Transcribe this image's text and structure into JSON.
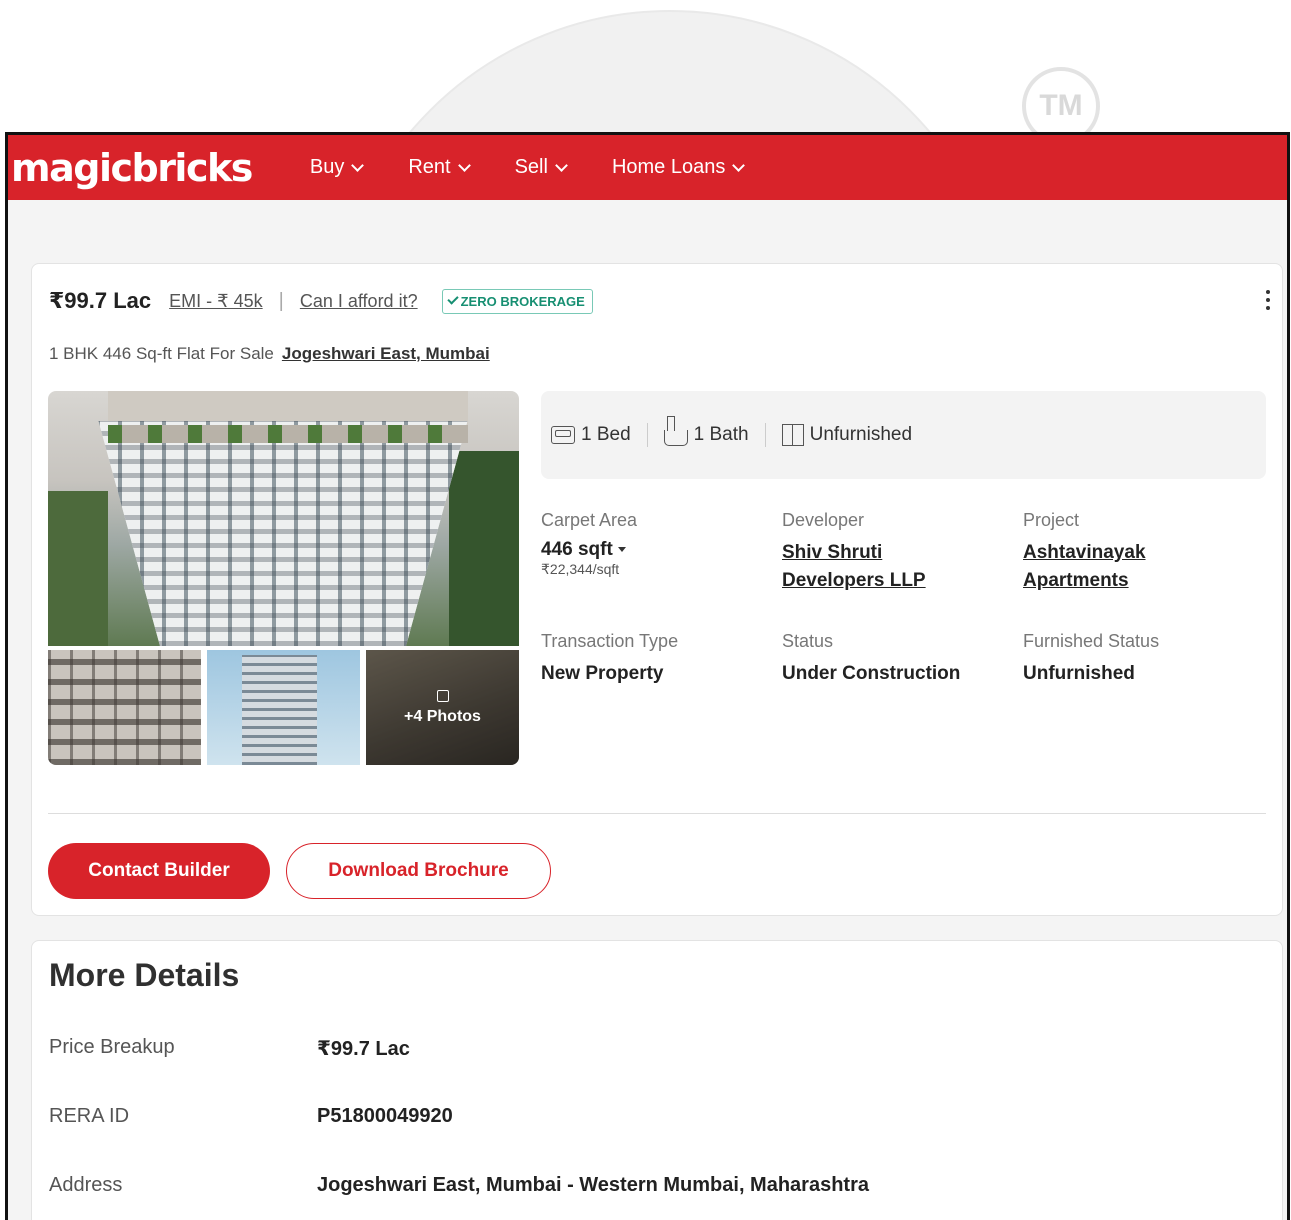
{
  "watermark": {
    "tm": "TM"
  },
  "nav": {
    "logo": "magicbricks",
    "items": [
      {
        "label": "Buy"
      },
      {
        "label": "Rent"
      },
      {
        "label": "Sell"
      },
      {
        "label": "Home Loans"
      }
    ]
  },
  "listing": {
    "price": "₹99.7 Lac",
    "emi": "EMI - ₹ 45k",
    "separator": "|",
    "afford": "Can I afford it?",
    "badge": "ZERO BROKERAGE",
    "subtitle": "1 BHK 446 Sq-ft Flat For Sale",
    "location": "Jogeshwari East, Mumbai",
    "photos_overlay": "+4 Photos",
    "amenities": {
      "bed": "1 Bed",
      "bath": "1 Bath",
      "furnishing": "Unfurnished"
    },
    "specs": {
      "carpet_area": {
        "label": "Carpet Area",
        "value": "446 sqft",
        "sub": "₹22,344/sqft"
      },
      "developer": {
        "label": "Developer",
        "line1": "Shiv Shruti",
        "line2": "Developers LLP"
      },
      "project": {
        "label": "Project",
        "line1": "Ashtavinayak",
        "line2": "Apartments"
      },
      "transaction_type": {
        "label": "Transaction Type",
        "value": "New Property"
      },
      "status": {
        "label": "Status",
        "value": "Under Construction"
      },
      "furnished_status": {
        "label": "Furnished Status",
        "value": "Unfurnished"
      }
    },
    "buttons": {
      "contact": "Contact Builder",
      "brochure": "Download Brochure"
    }
  },
  "more_details": {
    "title": "More Details",
    "rows": [
      {
        "label": "Price Breakup",
        "value": "₹99.7 Lac"
      },
      {
        "label": "RERA ID",
        "value": "P51800049920"
      },
      {
        "label": "Address",
        "value": "Jogeshwari East, Mumbai - Western Mumbai, Maharashtra"
      }
    ]
  },
  "colors": {
    "brand_red": "#d8232a",
    "badge_green": "#178f72"
  }
}
